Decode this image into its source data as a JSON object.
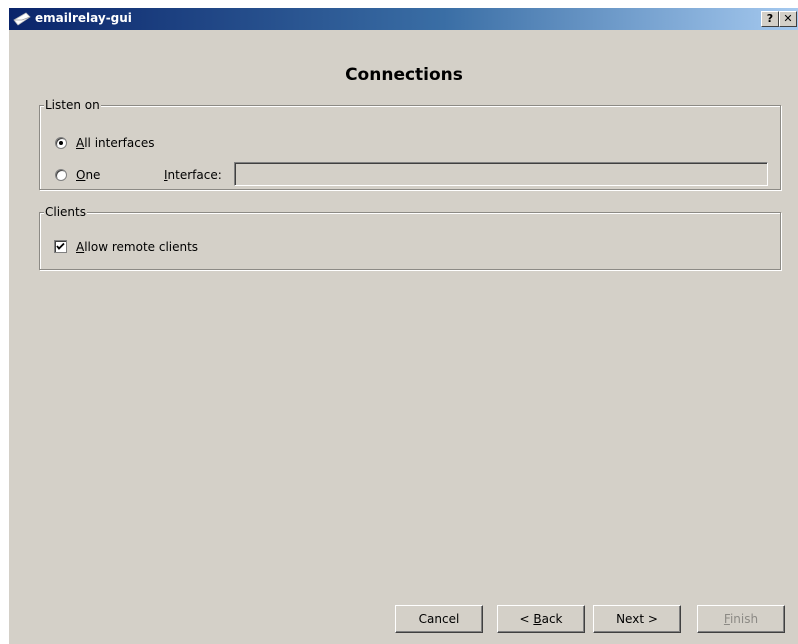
{
  "window": {
    "title": "emailrelay-gui",
    "help_button": "?",
    "close_button": "✕"
  },
  "page": {
    "title": "Connections"
  },
  "listen_on": {
    "legend": "Listen on",
    "all_interfaces": {
      "label_accel": "A",
      "label_rest": "ll interfaces",
      "selected": true
    },
    "one": {
      "label_accel": "O",
      "label_rest": "ne",
      "selected": false
    },
    "interface": {
      "label_accel": "I",
      "label_rest": "nterface:",
      "value": ""
    }
  },
  "clients": {
    "legend": "Clients",
    "allow_remote": {
      "label_accel": "A",
      "label_rest": "llow remote clients",
      "checked": true
    }
  },
  "buttons": {
    "cancel": "Cancel",
    "back_prefix": "< ",
    "back_accel": "B",
    "back_rest": "ack",
    "next": "Next >",
    "finish_accel": "F",
    "finish_rest": "inish",
    "finish_enabled": false
  },
  "icons": {
    "app": "envelope-icon",
    "help": "help-icon",
    "close": "close-icon"
  }
}
